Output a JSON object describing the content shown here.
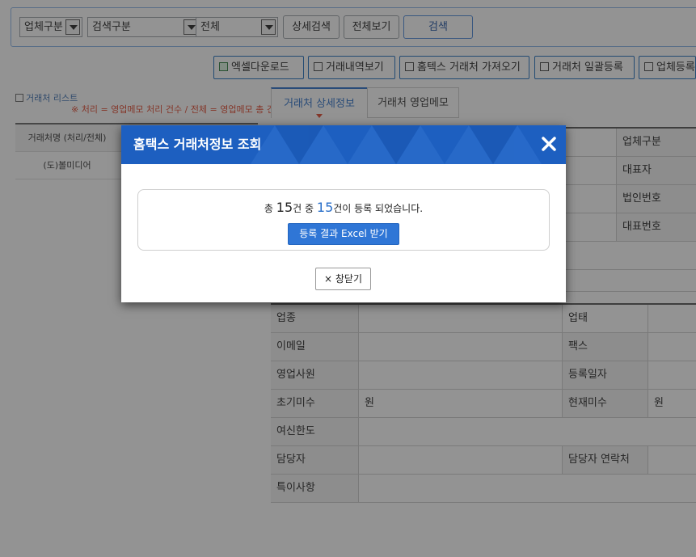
{
  "search": {
    "business_type": "업체구분",
    "search_type": "검색구분",
    "scope": "전체",
    "detail_search": "상세검색",
    "view_all": "전체보기",
    "search": "검색"
  },
  "toolbar": {
    "excel_download": "엑셀다운로드",
    "transaction_history": "거래내역보기",
    "hometax_import": "홈텍스 거래처 가져오기",
    "bulk_register": "거래처 일괄등록",
    "business_register": "업체등록"
  },
  "list": {
    "title": "거래처 리스트",
    "note": "※ 처리 = 영업메모 처리 건수 / 전체 = 영업메모 총 건수",
    "header": "거래처명 (처리/전체)",
    "rows": [
      "(도)볼미디어"
    ]
  },
  "tabs": [
    "거래처 상세정보",
    "거래처 영업메모"
  ],
  "detail": {
    "right_labels": [
      "업체구분",
      "대표자",
      "법인번호",
      "대표번호"
    ],
    "rows": [
      {
        "l1": "업종",
        "v1": "",
        "l2": "업태",
        "v2": ""
      },
      {
        "l1": "이메일",
        "v1": "",
        "l2": "팩스",
        "v2": ""
      },
      {
        "l1": "영업사원",
        "v1": "",
        "l2": "등록일자",
        "v2": ""
      },
      {
        "l1": "초기미수",
        "v1": "원",
        "l2": "현재미수",
        "v2": "원"
      },
      {
        "l1": "여신한도",
        "v1": "",
        "l2": "",
        "v2": ""
      },
      {
        "l1": "담당자",
        "v1": "",
        "l2": "담당자 연락처",
        "v2": ""
      },
      {
        "l1": "특이사항",
        "v1": "",
        "l2": "",
        "v2": ""
      }
    ]
  },
  "modal": {
    "title": "홈택스 거래처정보 조회",
    "msg_prefix": "총",
    "total": "15",
    "msg_middle": "건 중",
    "registered": "15",
    "msg_suffix": "건이 등록 되었습니다.",
    "excel_button": "등록 결과 Excel 받기",
    "close_button": "× 창닫기"
  },
  "colors": {
    "header_blue": "#1d5fc0",
    "accent_blue": "#2a6fc9",
    "note_red": "#e0462d"
  }
}
